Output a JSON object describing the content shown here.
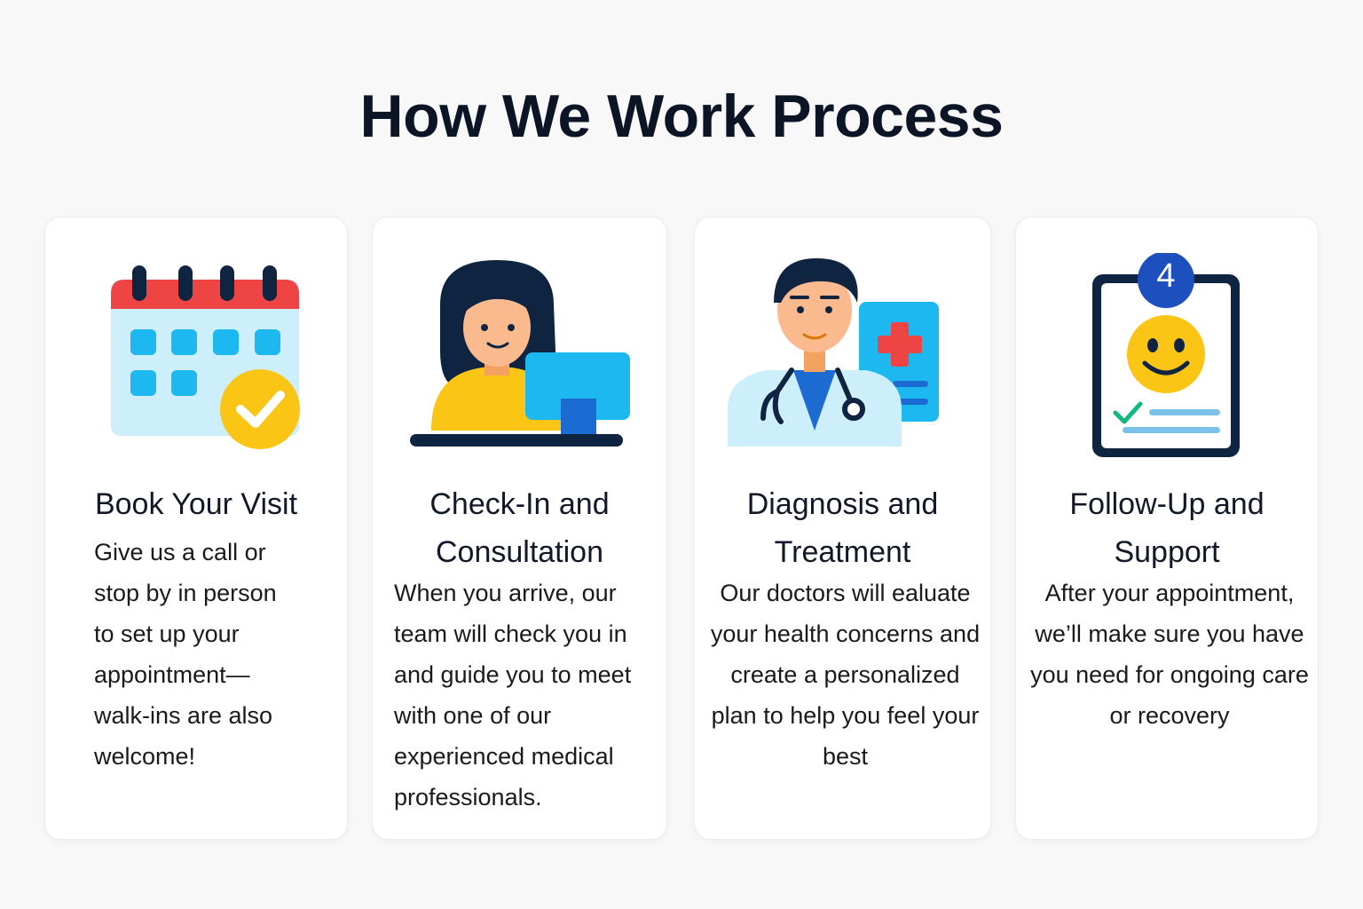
{
  "page": {
    "title": "How We Work Process"
  },
  "steps": [
    {
      "icon": "calendar-check-icon",
      "title": "Book Your Visit",
      "description": "Give us a call or stop by in person to set up your appointment—walk-ins are also welcome!"
    },
    {
      "icon": "patient-checkin-icon",
      "title": "Check-In and Consultation",
      "description": "When you arrive, our team will check you in and guide you to meet with one of our experienced medical professionals."
    },
    {
      "icon": "doctor-icon",
      "title": "Diagnosis and Treatment",
      "description": "Our doctors will ealuate your health concerns and create a personalized plan to help you feel your best"
    },
    {
      "icon": "clipboard-smiley-icon",
      "badge": "4",
      "title": "Follow-Up and Support",
      "description": "After your appointment, we’ll make sure you have you need for ongoing care or recovery"
    }
  ],
  "colors": {
    "background": "#f8f8f9",
    "card": "#ffffff",
    "heading": "#0c1526",
    "calendar_red": "#ef4444",
    "calendar_body": "#cdeefb",
    "accent_blue": "#1cb8ef",
    "accent_yellow": "#fbc515",
    "cross_red": "#ef4444",
    "badge_blue": "#1d4fbf",
    "navy": "#0f2440"
  }
}
